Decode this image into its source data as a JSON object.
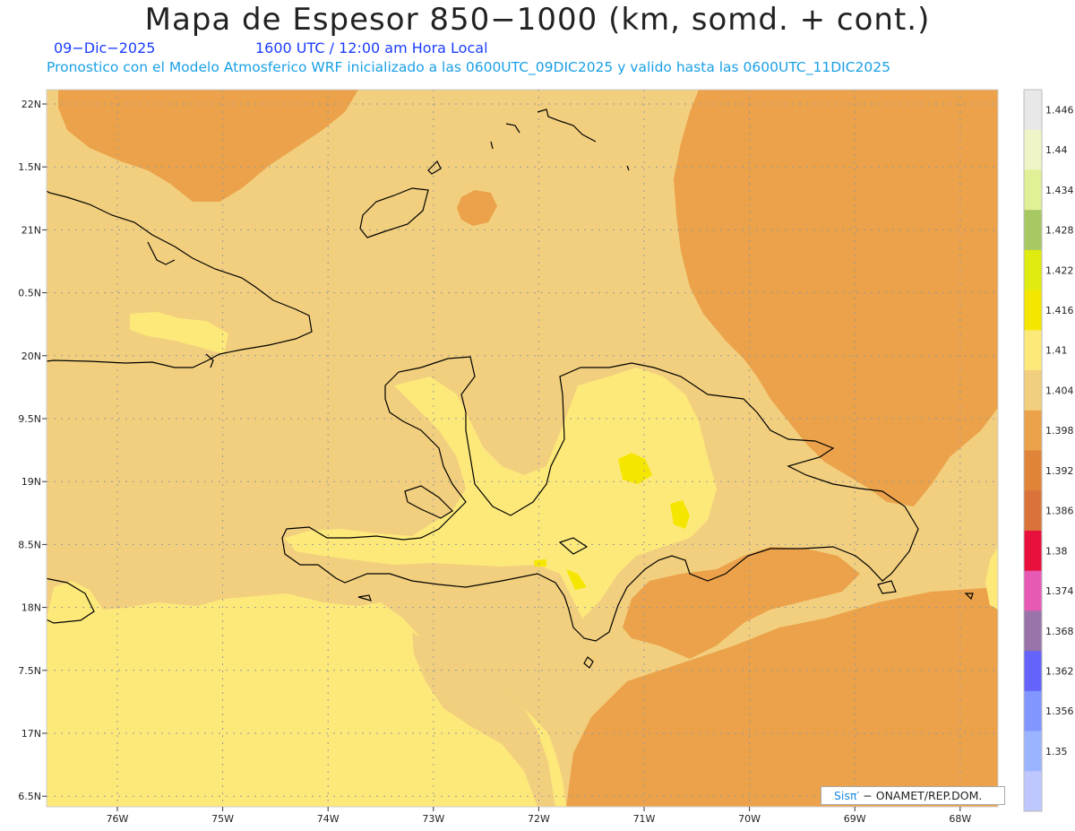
{
  "header": {
    "title": "Mapa de Espesor 850−1000 (km, somd. + cont.)",
    "date": "09−Dic−2025",
    "time": "1600 UTC / 12:00 am Hora Local",
    "description": "Pronostico con el Modelo Atmosferico WRF inicializado a las 0600UTC_09DIC2025 y valido hasta las  0600UTC_11DIC2025"
  },
  "map": {
    "lat_labels": [
      "22N",
      "1.5N",
      "21N",
      "0.5N",
      "20N",
      "9.5N",
      "19N",
      "8.5N",
      "18N",
      "7.5N",
      "17N",
      "6.5N"
    ],
    "lon_labels": [
      "76W",
      "75W",
      "74W",
      "73W",
      "72W",
      "71W",
      "70W",
      "69W",
      "68W"
    ],
    "lon_range": [
      -76.6,
      -67.6
    ],
    "lat_range": [
      16.4,
      22.1
    ]
  },
  "colorbar": {
    "labels": [
      "1.446",
      "1.44",
      "1.434",
      "1.428",
      "1.422",
      "1.416",
      "1.41",
      "1.404",
      "1.398",
      "1.392",
      "1.386",
      "1.38",
      "1.374",
      "1.368",
      "1.362",
      "1.356",
      "1.35"
    ],
    "colors": [
      "#e8e8e8",
      "#f0f5c8",
      "#e0f096",
      "#a8c864",
      "#e0eb10",
      "#f5e600",
      "#fde97a",
      "#f2cf7e",
      "#eba24a",
      "#e0843a",
      "#d9733a",
      "#e8103c",
      "#e65ab4",
      "#9874aa",
      "#6464fa",
      "#8296ff",
      "#9bb4ff",
      "#bec8ff"
    ]
  },
  "credit": {
    "sis": "Sisπ′",
    "org": "− ONAMET/REP.DOM."
  }
}
